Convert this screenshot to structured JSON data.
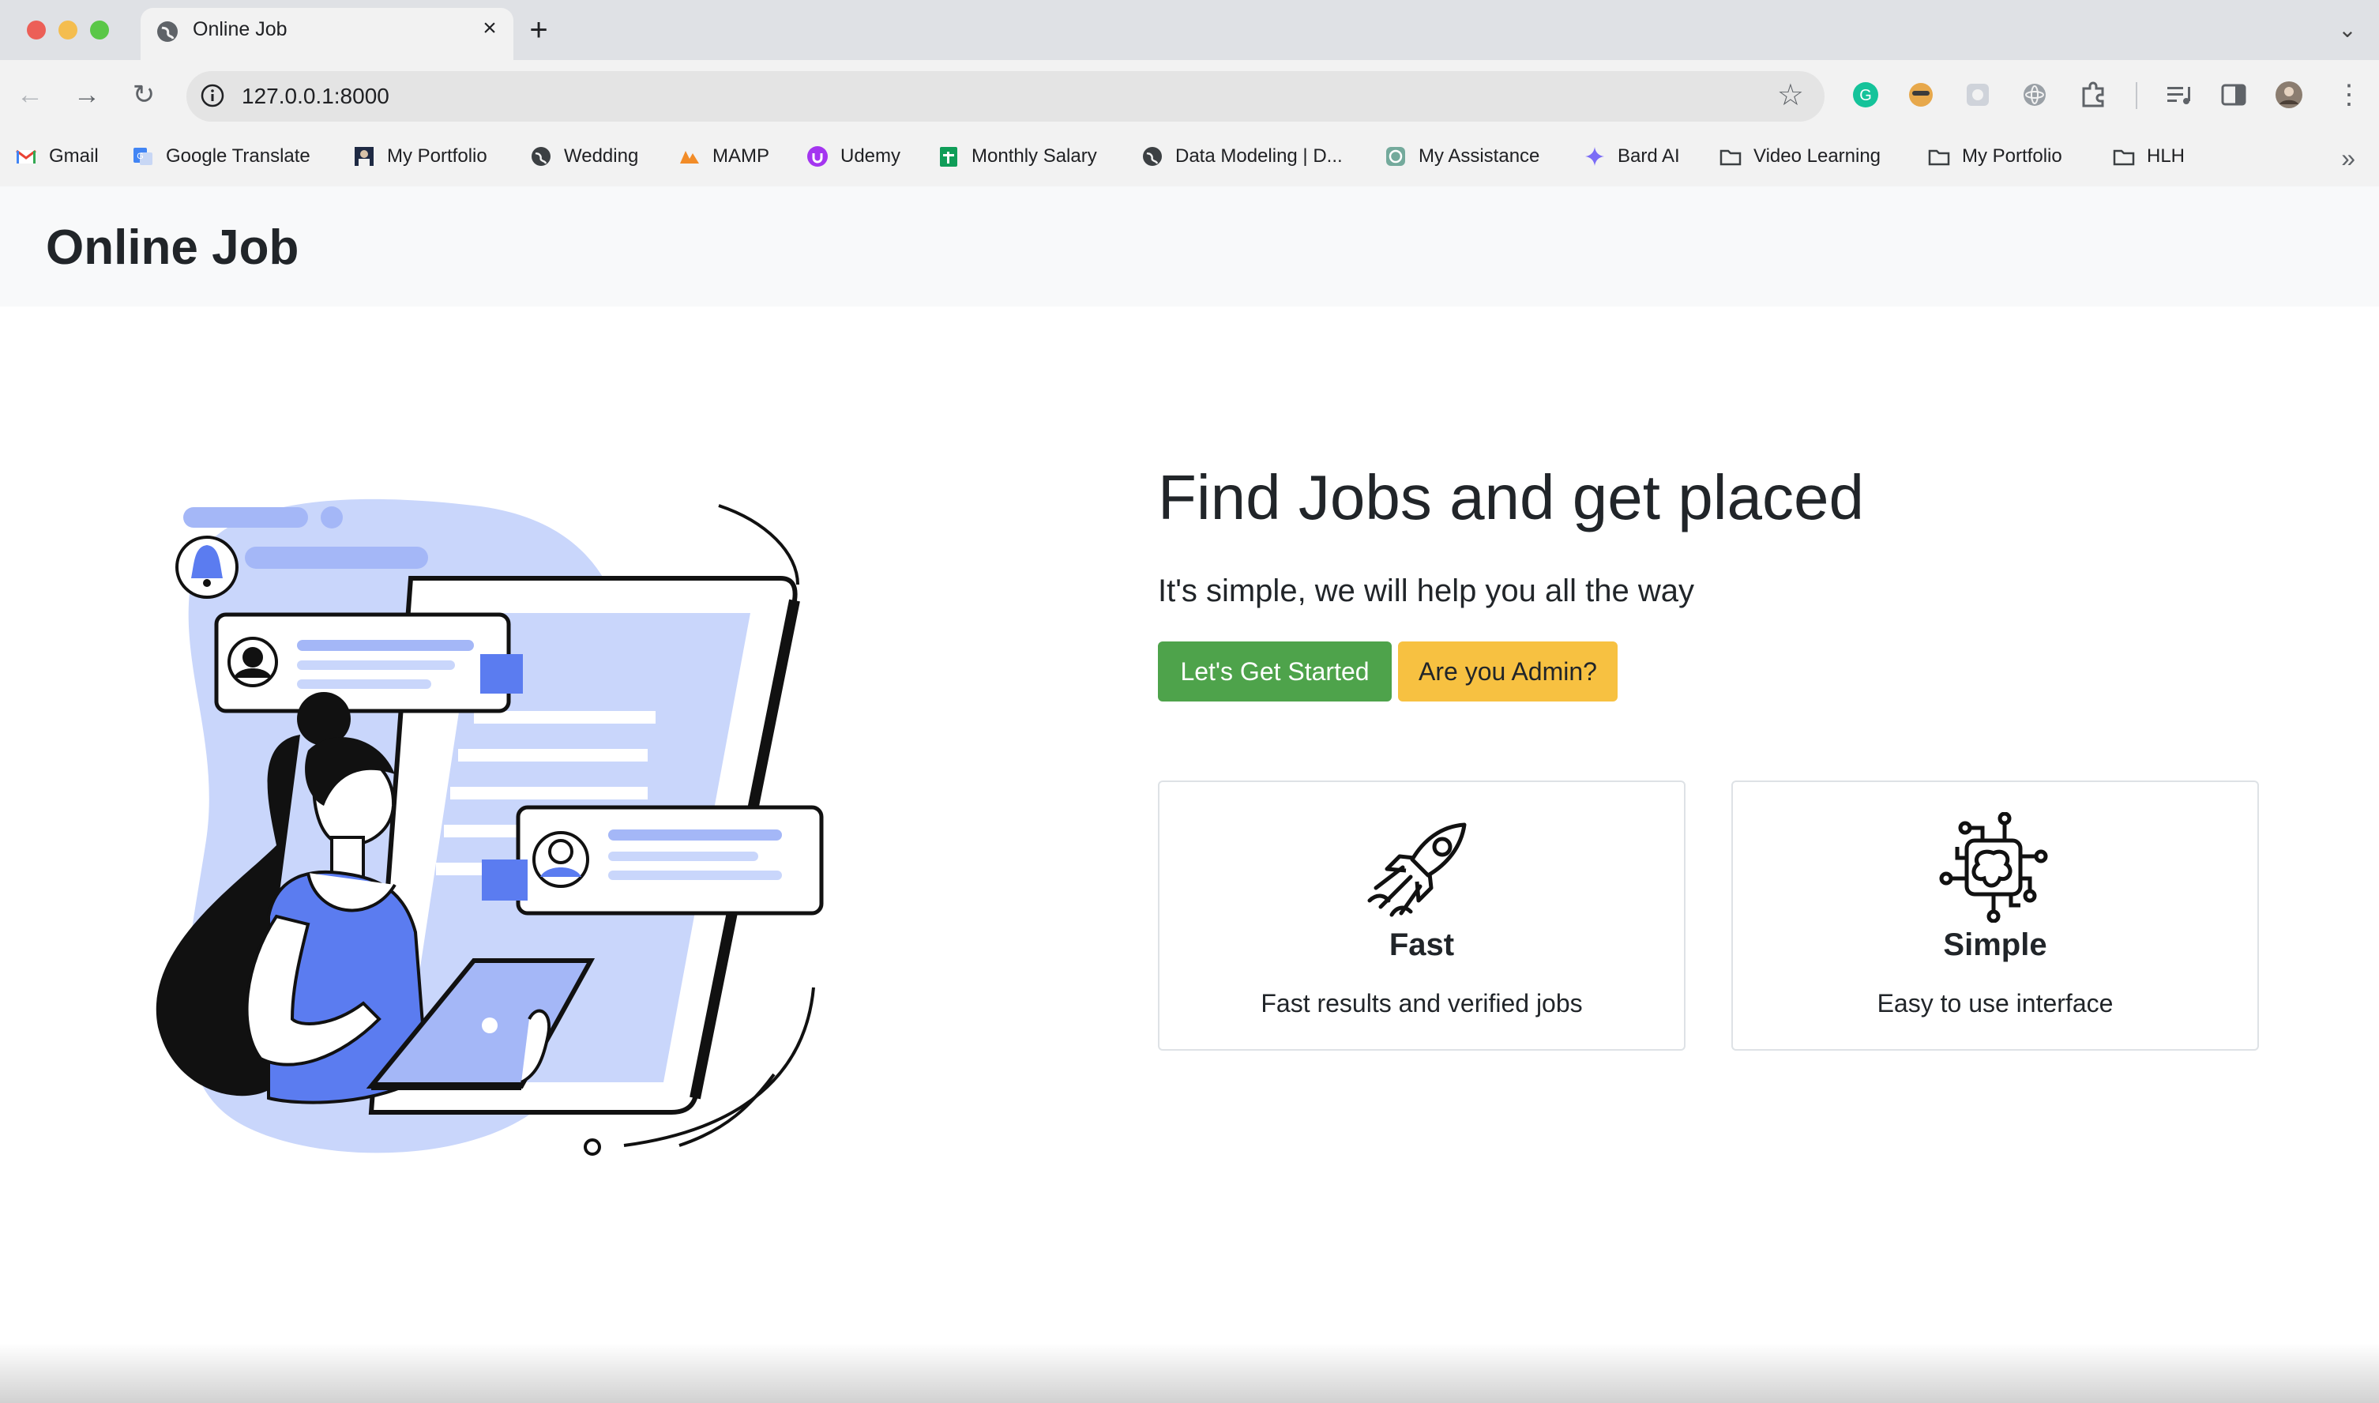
{
  "browser": {
    "tab_title": "Online Job",
    "url": "127.0.0.1:8000"
  },
  "bookmarks": [
    {
      "label": "Gmail",
      "icon": "gmail-icon"
    },
    {
      "label": "Google Translate",
      "icon": "google-translate-icon"
    },
    {
      "label": "My Portfolio",
      "icon": "portfolio-photo-icon"
    },
    {
      "label": "Wedding",
      "icon": "globe-icon"
    },
    {
      "label": "MAMP",
      "icon": "mamp-icon"
    },
    {
      "label": "Udemy",
      "icon": "udemy-icon"
    },
    {
      "label": "Monthly Salary",
      "icon": "sheets-icon"
    },
    {
      "label": "Data Modeling | D...",
      "icon": "globe-icon"
    },
    {
      "label": "My Assistance",
      "icon": "chatgpt-icon"
    },
    {
      "label": "Bard AI",
      "icon": "bard-icon"
    },
    {
      "label": "Video Learning",
      "icon": "folder-icon"
    },
    {
      "label": "My Portfolio",
      "icon": "folder-icon"
    },
    {
      "label": "HLH",
      "icon": "folder-icon"
    }
  ],
  "site": {
    "brand": "Online Job"
  },
  "hero": {
    "title": "Find Jobs and get placed",
    "subtitle": "It's simple, we will help you all the way",
    "primary_button": "Let's Get Started",
    "secondary_button": "Are you Admin?"
  },
  "features": [
    {
      "title": "Fast",
      "text": "Fast results and verified jobs",
      "icon": "rocket-icon"
    },
    {
      "title": "Simple",
      "text": "Easy to use interface",
      "icon": "chip-icon"
    }
  ],
  "colors": {
    "success": "#4ea34b",
    "warning": "#f7c141",
    "illustration_accent": "#5b7cf0",
    "illustration_light": "#c9d6fb"
  }
}
